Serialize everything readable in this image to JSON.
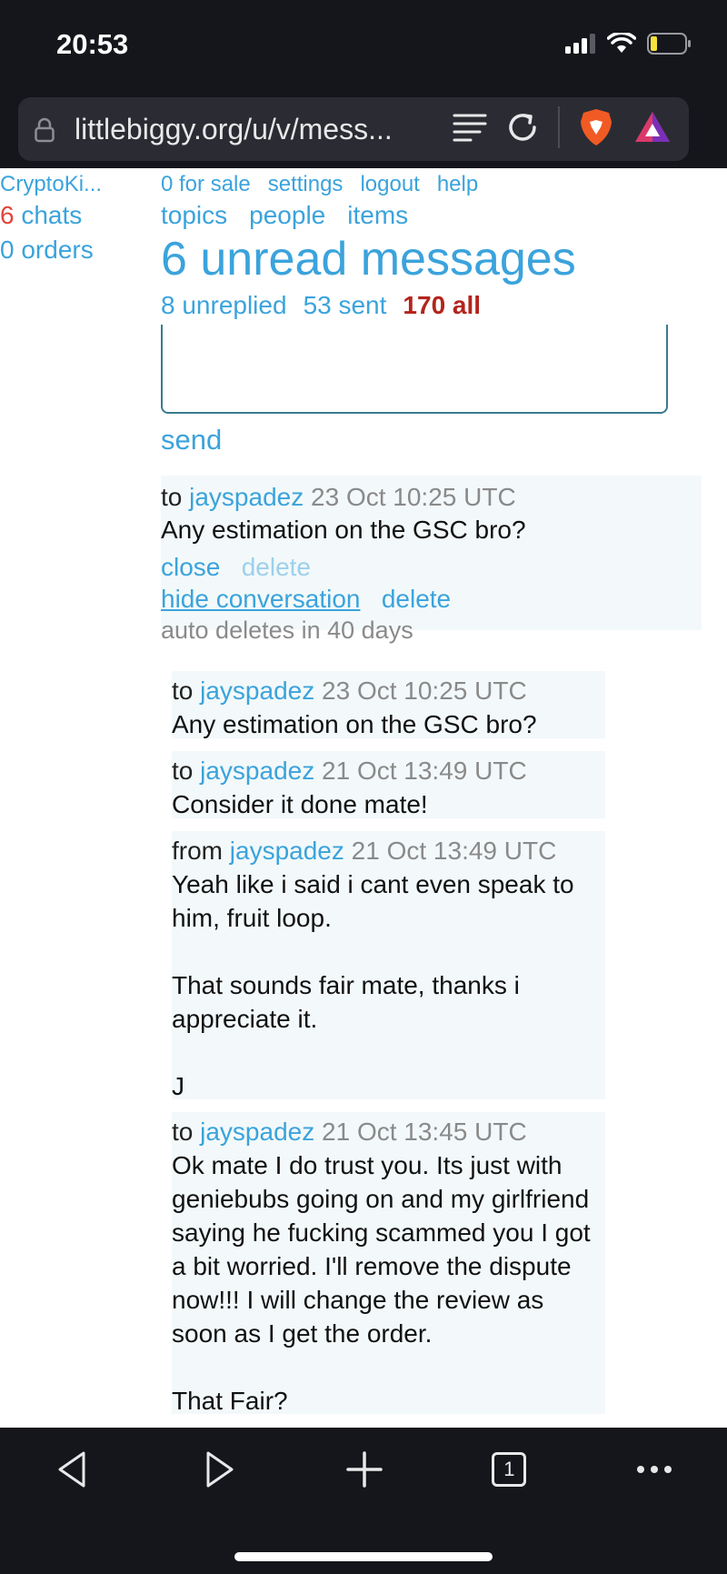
{
  "status_bar": {
    "time": "20:53"
  },
  "browser": {
    "url": "littlebiggy.org/u/v/mess...",
    "tab_count": "1"
  },
  "sidebar": {
    "username": "CryptoKi...",
    "chats_count": "6",
    "chats_label": "chats",
    "orders": "0 orders"
  },
  "top_links": [
    "0 for sale",
    "settings",
    "logout",
    "help"
  ],
  "nav": [
    "topics",
    "people",
    "items"
  ],
  "heading": "6 unread messages",
  "counts": {
    "unreplied": "8 unreplied",
    "sent": "53 sent",
    "all": "170 all"
  },
  "compose": {
    "send_label": "send"
  },
  "selected_message": {
    "direction": "to",
    "user": "jayspadez",
    "time": "23 Oct 10:25 UTC",
    "text": "Any estimation on the GSC bro?",
    "close": "close",
    "delete_faint": "delete",
    "hide": "hide conversation",
    "delete": "delete",
    "auto_delete": "auto deletes in 40 days"
  },
  "conversation": [
    {
      "direction": "to",
      "user": "jayspadez",
      "time": "23 Oct 10:25 UTC",
      "text": "Any estimation on the GSC bro?"
    },
    {
      "direction": "to",
      "user": "jayspadez",
      "time": "21 Oct 13:49 UTC",
      "text": "Consider it done mate!"
    },
    {
      "direction": "from",
      "user": "jayspadez",
      "time": "21 Oct 13:49 UTC",
      "text": "Yeah like i said i cant even speak to\nhim, fruit loop.\n\nThat sounds fair mate, thanks i\nappreciate it.\n\nJ"
    },
    {
      "direction": "to",
      "user": "jayspadez",
      "time": "21 Oct 13:45 UTC",
      "text": "Ok mate I do trust you. Its just with\ngeniebubs going on and my girlfriend\nsaying he fucking scammed you I got\na bit worried. I'll remove the dispute\nnow!!! I will change the review as\nsoon as I get the order.\n\nThat Fair?"
    }
  ],
  "colors": {
    "link": "#3ba3dc",
    "unread_red": "#e0463d",
    "all_red": "#b3241c",
    "bar_bg": "#15161b",
    "msg_bg": "#f3f9fa"
  }
}
